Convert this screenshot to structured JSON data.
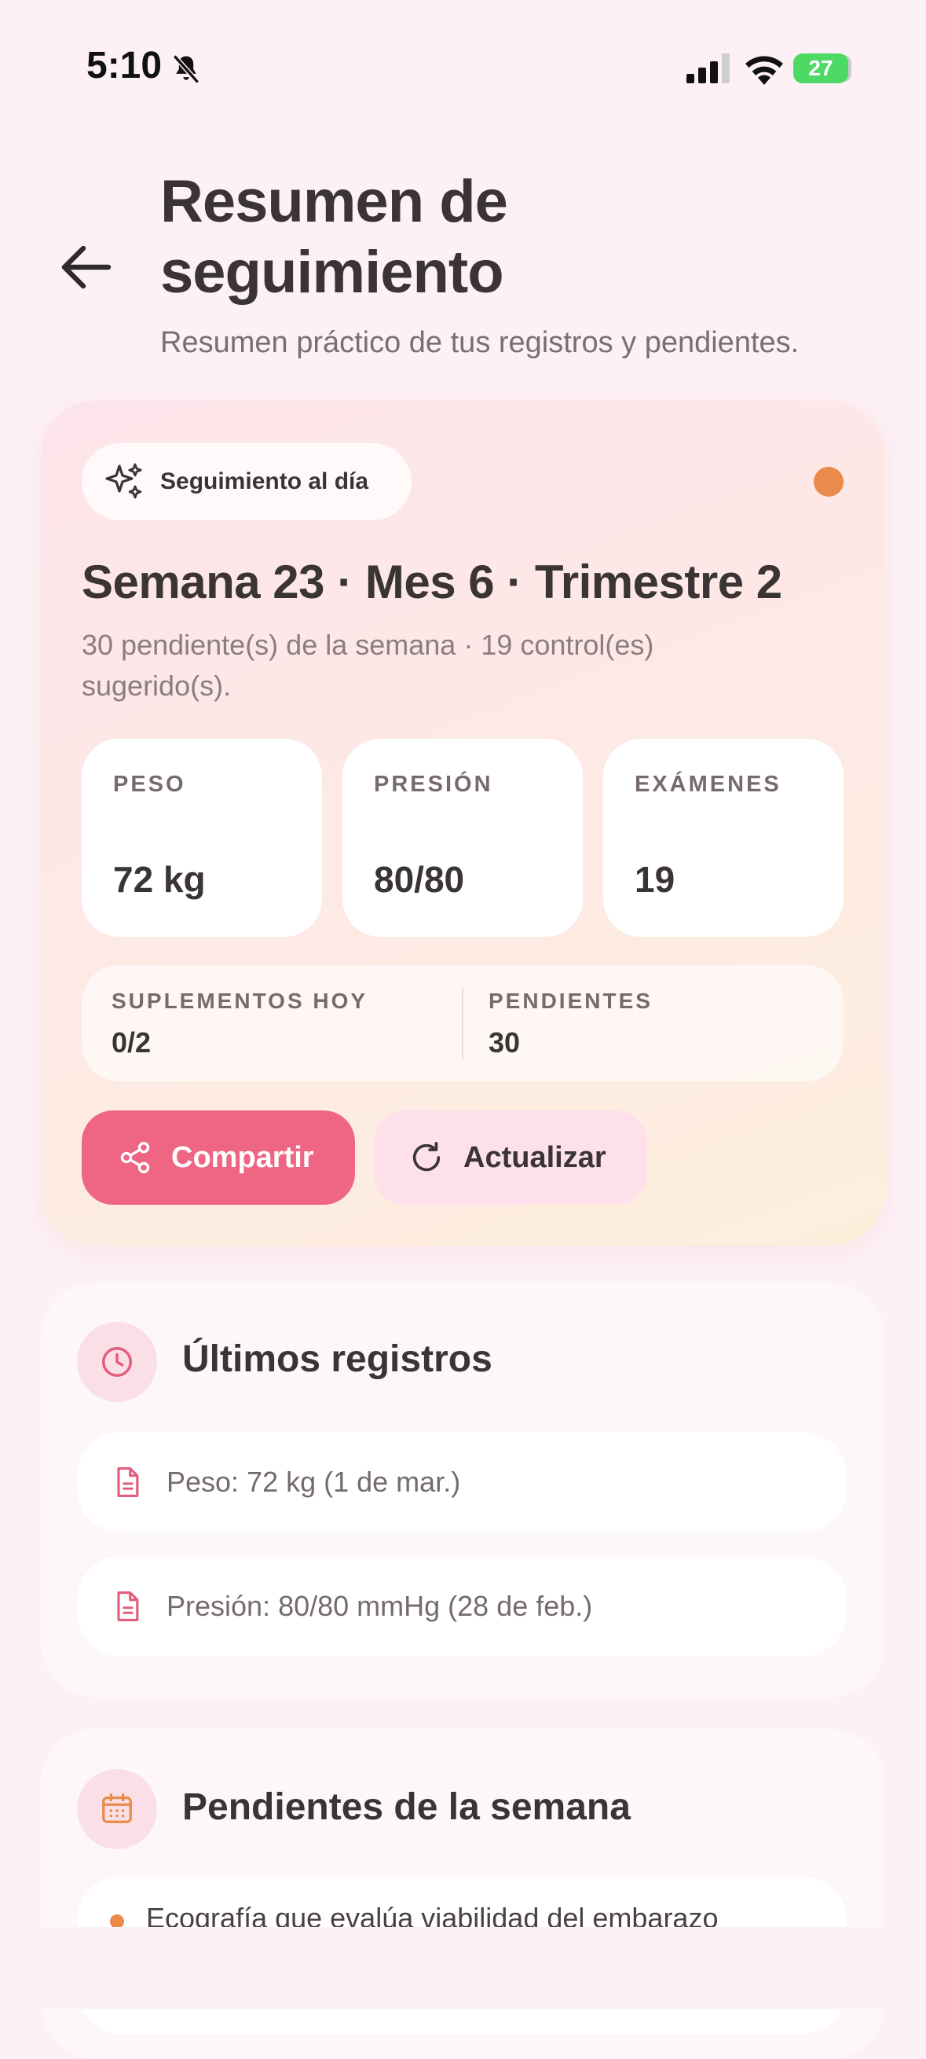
{
  "status_bar": {
    "time": "5:10",
    "battery": "27"
  },
  "header": {
    "title_line1": "Resumen de",
    "title_line2": "seguimiento",
    "subtitle": "Resumen práctico de tus registros y pendientes."
  },
  "hero": {
    "badge": "Seguimiento al día",
    "heading": "Semana 23 · Mes 6 · Trimestre 2",
    "description": "30 pendiente(s) de la semana · 19 control(es) sugerido(s).",
    "stats": [
      {
        "label": "PESO",
        "value": "72 kg"
      },
      {
        "label": "PRESIÓN",
        "value": "80/80"
      },
      {
        "label": "EXÁMENES",
        "value": "19"
      }
    ],
    "summary": {
      "supplements_label": "SUPLEMENTOS HOY",
      "supplements_value": "0/2",
      "pending_label": "PENDIENTES",
      "pending_value": "30"
    },
    "share_label": "Compartir",
    "refresh_label": "Actualizar"
  },
  "latest_records": {
    "title": "Últimos registros",
    "items": [
      "Peso: 72 kg (1 de mar.)",
      "Presión: 80/80 mmHg (28 de feb.)"
    ]
  },
  "weekly_pending": {
    "title": "Pendientes de la semana",
    "items": [
      "Ecografía que evalúa viabilidad del embarazo"
    ]
  },
  "colors": {
    "accent_pink": "#ee6684",
    "accent_orange": "#ea8a4b",
    "background": "#fdf1f5"
  }
}
